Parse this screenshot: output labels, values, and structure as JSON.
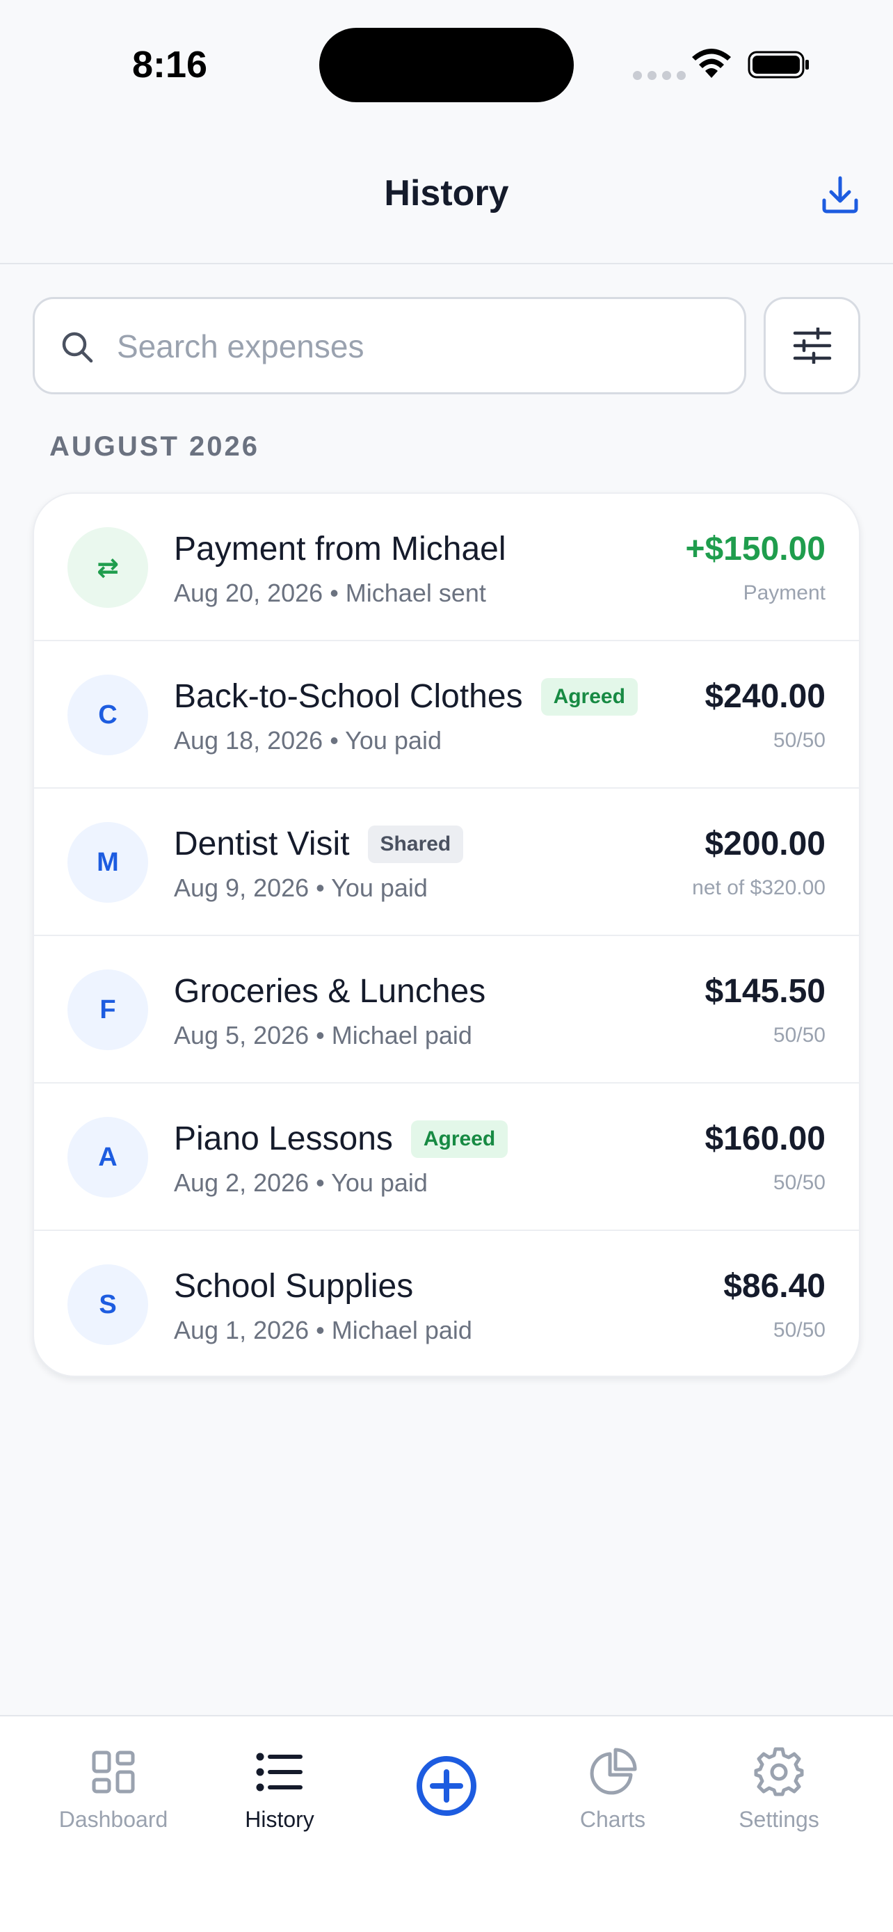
{
  "status_bar": {
    "time": "8:16"
  },
  "header": {
    "title": "History",
    "download_icon": "download-icon"
  },
  "search": {
    "placeholder": "Search expenses",
    "value": ""
  },
  "section": {
    "label": "AUGUST 2026"
  },
  "colors": {
    "accent": "#1d5ce0",
    "positive": "#1f9d4d",
    "agreed_bg": "#e3f7e9"
  },
  "transactions": [
    {
      "avatar": "⇄",
      "kind": "payment",
      "title": "Payment from Michael",
      "badge": "",
      "subtitle": "Aug 20, 2026 • Michael sent",
      "amount": "+$150.00",
      "note": "Payment"
    },
    {
      "avatar": "C",
      "kind": "expense",
      "title": "Back-to-School Clothes",
      "badge": "Agreed",
      "subtitle": "Aug 18, 2026 • You paid",
      "amount": "$240.00",
      "note": "50/50"
    },
    {
      "avatar": "M",
      "kind": "expense",
      "title": "Dentist Visit",
      "badge": "Shared",
      "subtitle": "Aug 9, 2026 • You paid",
      "amount": "$200.00",
      "note": "net of $320.00"
    },
    {
      "avatar": "F",
      "kind": "expense",
      "title": "Groceries & Lunches",
      "badge": "",
      "subtitle": "Aug 5, 2026 • Michael paid",
      "amount": "$145.50",
      "note": "50/50"
    },
    {
      "avatar": "A",
      "kind": "expense",
      "title": "Piano Lessons",
      "badge": "Agreed",
      "subtitle": "Aug 2, 2026 • You paid",
      "amount": "$160.00",
      "note": "50/50"
    },
    {
      "avatar": "S",
      "kind": "expense",
      "title": "School Supplies",
      "badge": "",
      "subtitle": "Aug 1, 2026 • Michael paid",
      "amount": "$86.40",
      "note": "50/50"
    }
  ],
  "tab_bar": {
    "items": [
      {
        "label": "Dashboard",
        "icon": "grid-icon",
        "active": false
      },
      {
        "label": "History",
        "icon": "list-icon",
        "active": true
      },
      {
        "label": "",
        "icon": "add-circle-icon",
        "active": false
      },
      {
        "label": "Charts",
        "icon": "pie-chart-icon",
        "active": false
      },
      {
        "label": "Settings",
        "icon": "gear-icon",
        "active": false
      }
    ]
  }
}
